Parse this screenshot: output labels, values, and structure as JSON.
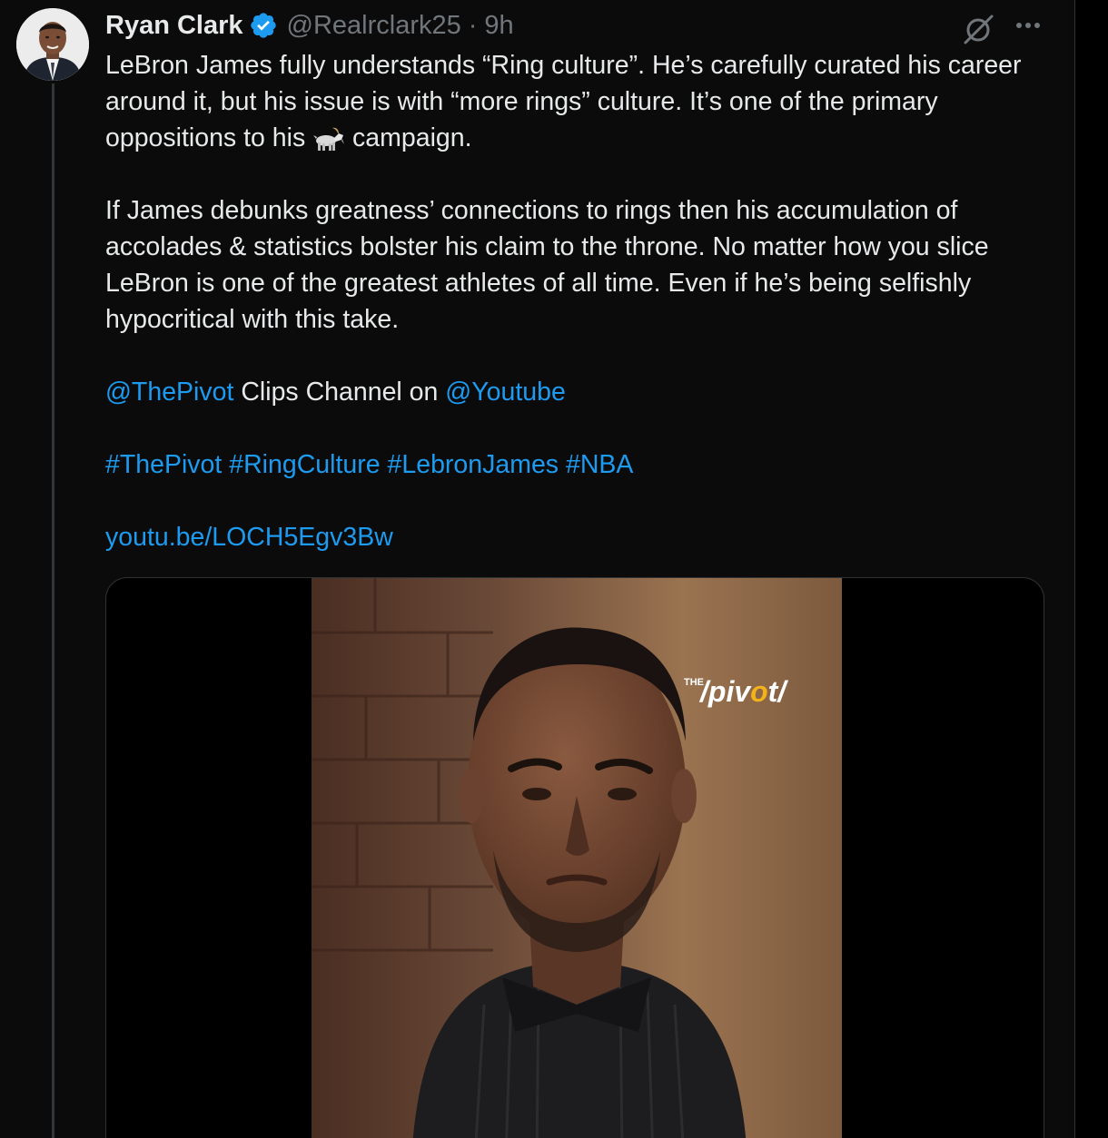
{
  "tweet": {
    "author_name": "Ryan Clark",
    "handle": "@Realrclark25",
    "separator": "·",
    "time": "9h",
    "paragraph_1_before_emoji": "LeBron James fully understands “Ring culture”. He’s carefully curated his career around it, but his issue is with “more rings” culture. It’s one of the primary oppositions to his ",
    "emoji": "goat",
    "paragraph_1_after_emoji": " campaign.",
    "paragraph_2": "If James debunks greatness’ connections to rings then his accumulation of accolades & statistics bolster his claim to the throne. No matter how you slice LeBron is one of the greatest athletes of all time. Even if he’s being selfishly hypocritical with this take.",
    "mention_1": "@ThePivot",
    "mention_text": " Clips Channel on ",
    "mention_2": "@Youtube",
    "hashtags": [
      "#ThePivot",
      "#RingCulture",
      "#LebronJames",
      "#NBA"
    ],
    "link": "youtu.be/LOCH5Egv3Bw"
  },
  "media": {
    "logo_prefix": "THE",
    "logo_text_1": "/piv",
    "logo_text_o": "o",
    "logo_text_2": "t/"
  },
  "icons": {
    "verified": "verified-badge-icon",
    "grok": "grok-icon",
    "more": "more-icon"
  },
  "colors": {
    "background": "#0b0b0b",
    "text": "#e7e9ea",
    "muted": "#71767b",
    "link": "#1d9bf0",
    "verified": "#1d9bf0",
    "logo_accent": "#f2b21a"
  }
}
